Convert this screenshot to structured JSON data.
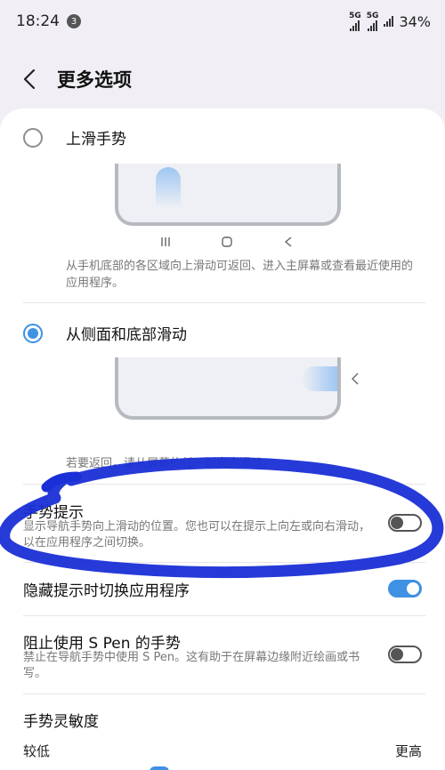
{
  "status_bar": {
    "time": "18:24",
    "notification_count": "3",
    "sim1_label": "5G",
    "sim2_label": "5G",
    "battery": "34%"
  },
  "header": {
    "title": "更多选项"
  },
  "options": {
    "swipe_up": {
      "label": "上滑手势",
      "selected": false,
      "description": "从手机底部的各区域向上滑动可返回、进入主屏幕或查看最近使用的应用程序。"
    },
    "side_bottom": {
      "label": "从侧面和底部滑动",
      "selected": true,
      "description": "若要返回，请从屏幕的任一侧向内滑动。"
    }
  },
  "settings": {
    "gesture_hint": {
      "title": "手势提示",
      "description": "显示导航手势向上滑动的位置。您也可以在提示上向左或向右滑动，以在应用程序之间切换。",
      "enabled": false
    },
    "switch_apps_hidden": {
      "title": "隐藏提示时切换应用程序",
      "enabled": true
    },
    "block_spen": {
      "title": "阻止使用 S Pen 的手势",
      "description": "禁止在导航手势中使用 S Pen。这有助于在屏幕边缘附近绘画或书写。",
      "enabled": false
    },
    "sensitivity": {
      "title": "手势灵敏度",
      "low_label": "较低",
      "high_label": "更高"
    }
  },
  "colors": {
    "accent": "#3e91e3",
    "annotation": "#1a2fd6"
  }
}
